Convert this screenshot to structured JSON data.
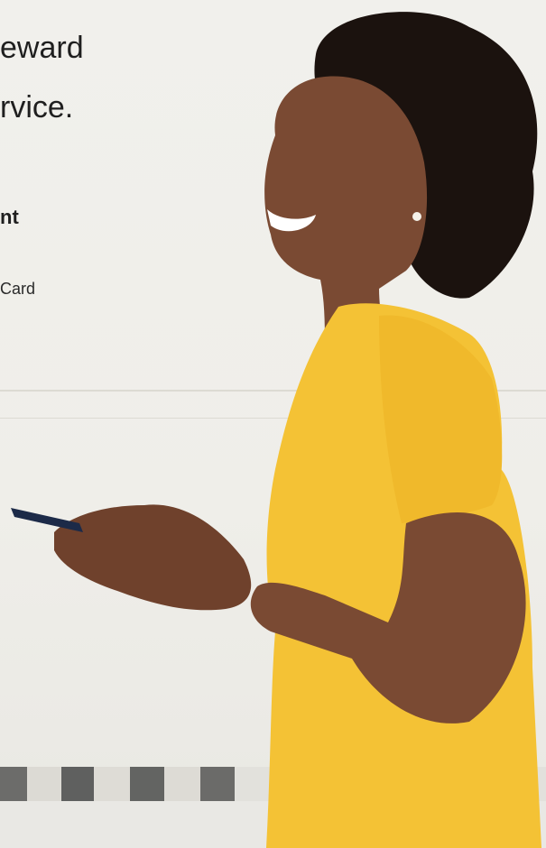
{
  "hero": {
    "headline": "eward\nrvice.",
    "cta": "nt",
    "note": "Card"
  },
  "colors": {
    "shirt": "#f4c235",
    "skin": "#7a4a33",
    "hair": "#1b120e",
    "phone": "#1c2a48",
    "wall": "#efeee9"
  }
}
